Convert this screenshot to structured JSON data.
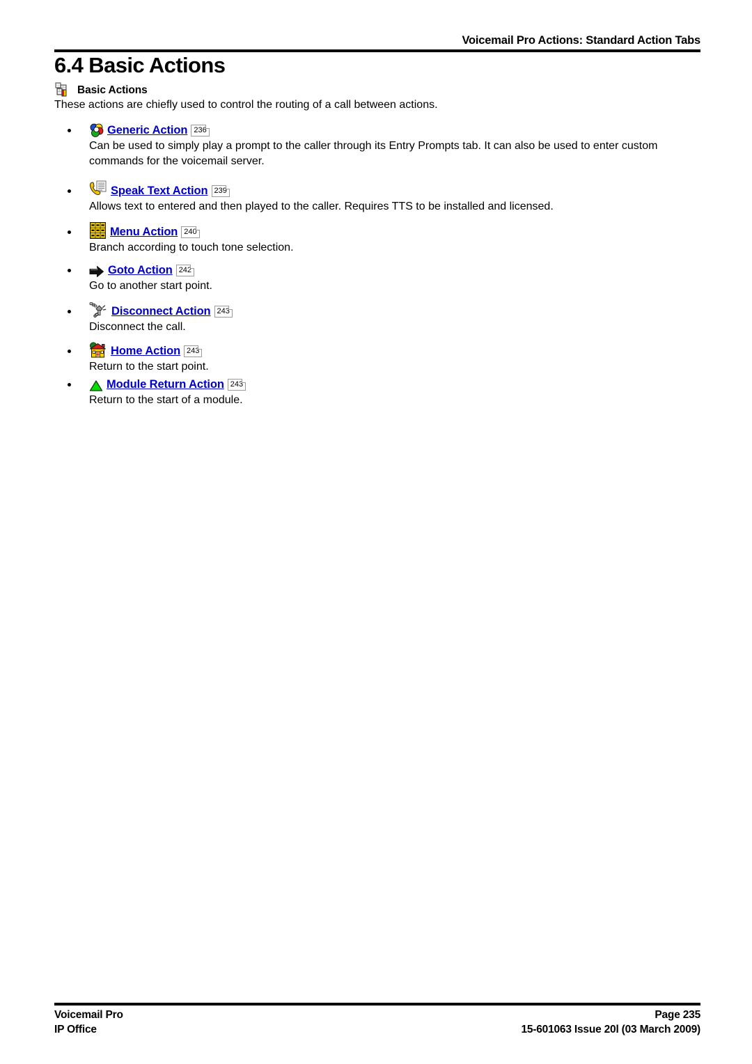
{
  "header": {
    "title": "Voicemail Pro Actions: Standard Action Tabs"
  },
  "section": {
    "number_and_title": "6.4 Basic Actions",
    "topic_icon": "basic-actions-icon",
    "topic_label": "Basic Actions",
    "intro": "These actions are chiefly used to control the routing of a call between actions."
  },
  "items": [
    {
      "icon": "generic-action-icon",
      "label": "Generic Action",
      "pageref": "236",
      "description": "Can be used to simply play a prompt to the caller through its Entry Prompts tab. It can also be used to enter custom commands for the voicemail server."
    },
    {
      "icon": "speak-text-action-icon",
      "label": "Speak Text Action",
      "pageref": "239",
      "description": "Allows text to entered and then played to the caller. Requires TTS to be installed and licensed."
    },
    {
      "icon": "menu-action-icon",
      "label": "Menu Action",
      "pageref": "240",
      "description": "Branch according to touch tone selection."
    },
    {
      "icon": "goto-action-icon",
      "label": "Goto Action",
      "pageref": "242",
      "description": "Go to another start point."
    },
    {
      "icon": "disconnect-action-icon",
      "label": "Disconnect Action",
      "pageref": "243",
      "description": "Disconnect the call."
    },
    {
      "icon": "home-action-icon",
      "label": "Home Action",
      "pageref": "243",
      "description": "Return to the start point."
    },
    {
      "icon": "module-return-action-icon",
      "label": "Module Return Action",
      "pageref": "243",
      "description": "Return to the start of a module."
    }
  ],
  "footer": {
    "left_line1": "Voicemail Pro",
    "left_line2": "IP Office",
    "right_line1": "Page 235",
    "right_line2": "15-601063 Issue 20l (03 March 2009)"
  },
  "colors": {
    "link": "#0000CC",
    "rule": "#000000",
    "text": "#000000"
  }
}
